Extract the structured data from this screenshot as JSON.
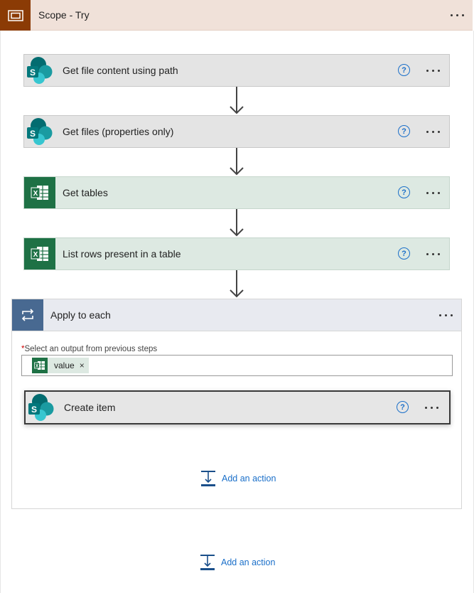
{
  "scope": {
    "title": "Scope - Try"
  },
  "steps": [
    {
      "label": "Get file content using path",
      "icon": "sharepoint-icon"
    },
    {
      "label": "Get files (properties only)",
      "icon": "sharepoint-icon"
    },
    {
      "label": "Get tables",
      "icon": "excel-icon"
    },
    {
      "label": "List rows present in a table",
      "icon": "excel-icon"
    }
  ],
  "apply_each": {
    "title": "Apply to each",
    "field_required_mark": "*",
    "field_label": "Select an output from previous steps",
    "token_value": "value",
    "token_close": "×",
    "inner_action": {
      "label": "Create item",
      "icon": "sharepoint-icon"
    },
    "add_action": "Add an action"
  },
  "add_action": "Add an action",
  "help_glyph": "?",
  "colors": {
    "scope_header": "#f0e1d9",
    "scope_icon": "#8b3b05",
    "excel_green": "#1e7145",
    "loop_blue": "#486991",
    "link_blue": "#1a6fc9"
  }
}
